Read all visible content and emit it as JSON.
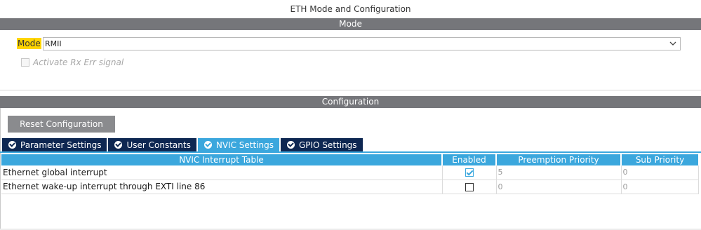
{
  "window": {
    "title": "ETH Mode and Configuration"
  },
  "mode_section": {
    "header": "Mode",
    "mode_label": "Mode",
    "mode_value": "RMII",
    "rx_err_label": "Activate Rx Err signal",
    "rx_err_checked": false
  },
  "config_section": {
    "header": "Configuration",
    "reset_button": "Reset Configuration",
    "tabs": [
      {
        "label": "Parameter Settings",
        "icon": "check-circle-icon",
        "active": false
      },
      {
        "label": "User Constants",
        "icon": "check-circle-icon",
        "active": false
      },
      {
        "label": "NVIC Settings",
        "icon": "check-circle-icon",
        "active": true
      },
      {
        "label": "GPIO Settings",
        "icon": "check-circle-icon",
        "active": false
      }
    ],
    "table": {
      "columns": [
        "NVIC Interrupt Table",
        "Enabled",
        "Preemption Priority",
        "Sub Priority"
      ],
      "rows": [
        {
          "name": "Ethernet global interrupt",
          "enabled": true,
          "preemption": "5",
          "sub": "0"
        },
        {
          "name": "Ethernet wake-up interrupt through EXTI line 86",
          "enabled": false,
          "preemption": "0",
          "sub": "0"
        }
      ]
    }
  },
  "colors": {
    "section_header": "#75767a",
    "tab_inactive": "#0e2752",
    "tab_active": "#3ba7dd",
    "mode_highlight": "#ffd500",
    "button_gray": "#8a8b8e"
  }
}
